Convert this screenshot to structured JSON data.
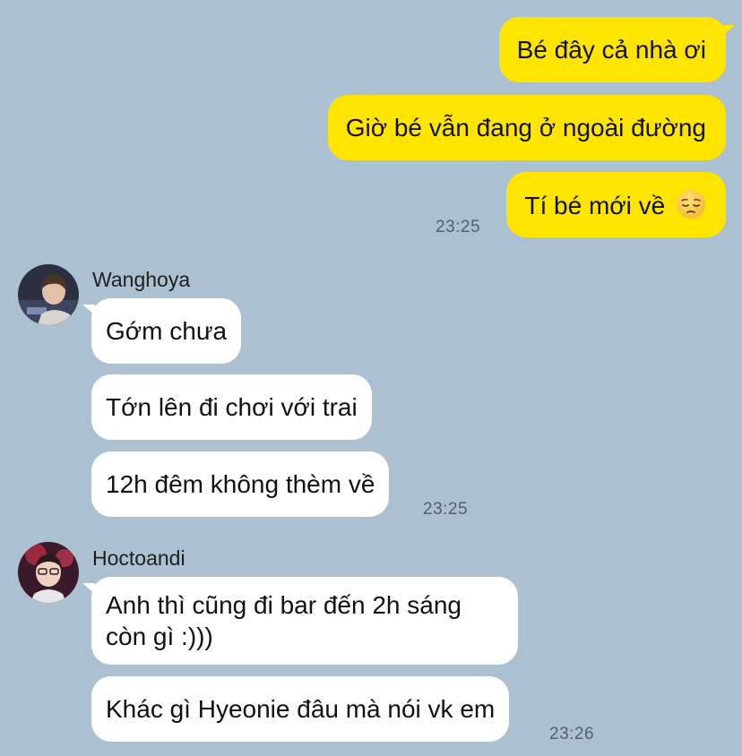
{
  "outgoing": {
    "messages": [
      "Bé đây cả nhà ơi",
      "Giờ bé vẫn đang ở ngoài đường",
      "Tí bé mới về"
    ],
    "emoji": "pensive-face",
    "time": "23:25"
  },
  "group1": {
    "sender": "Wanghoya",
    "messages": [
      "Gớm chưa",
      "Tớn lên đi chơi với trai",
      "12h đêm không thèm về"
    ],
    "time": "23:25"
  },
  "group2": {
    "sender": "Hoctoandi",
    "messages": [
      "Anh thì cũng đi bar đến 2h sáng còn gì :)))",
      "Khác gì Hyeonie đâu mà nói vk em"
    ],
    "time": "23:26"
  },
  "colors": {
    "background": "#abc1d1",
    "outgoing_bubble": "#fee500",
    "incoming_bubble": "#ffffff"
  }
}
